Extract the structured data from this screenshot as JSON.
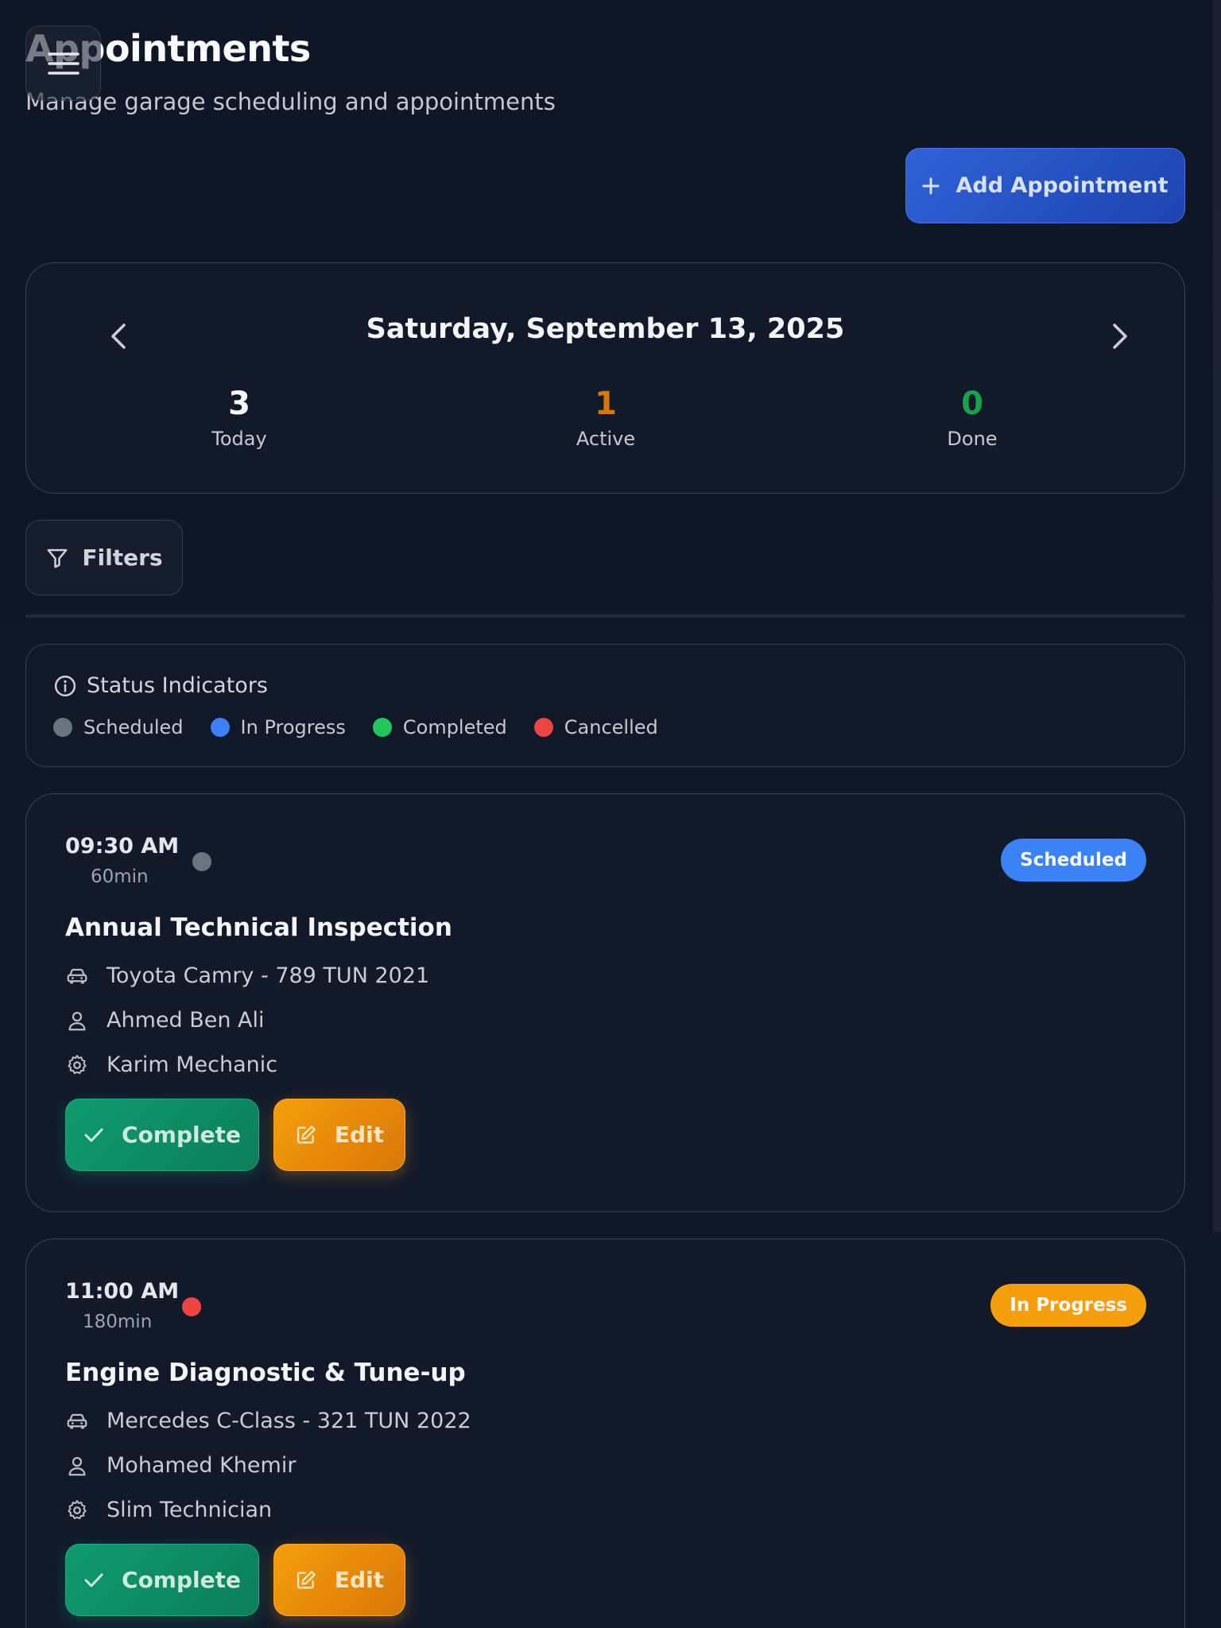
{
  "header": {
    "title": "Appointments",
    "subtitle": "Manage garage scheduling and appointments",
    "menu_icon": "hamburger-icon",
    "add_button_label": "Add Appointment"
  },
  "date_nav": {
    "date": "Saturday, September 13, 2025",
    "stats": [
      {
        "value": "3",
        "label": "Today",
        "color": "#f9fafb"
      },
      {
        "value": "1",
        "label": "Active",
        "color": "#d97706"
      },
      {
        "value": "0",
        "label": "Done",
        "color": "#16a34a"
      }
    ]
  },
  "filters": {
    "label": "Filters"
  },
  "legend": {
    "title": "Status Indicators",
    "items": [
      {
        "label": "Scheduled",
        "color": "#6b7280"
      },
      {
        "label": "In Progress",
        "color": "#3b82f6"
      },
      {
        "label": "Completed",
        "color": "#22c55e"
      },
      {
        "label": "Cancelled",
        "color": "#ef4444"
      }
    ]
  },
  "appointments": [
    {
      "time": "09:30 AM",
      "duration": "60min",
      "dot_color": "#6b7280",
      "status": "Scheduled",
      "status_color": "#3b82f6",
      "title": "Annual Technical Inspection",
      "vehicle": "Toyota Camry - 789 TUN 2021",
      "customer": "Ahmed Ben Ali",
      "mechanic": "Karim Mechanic",
      "complete_label": "Complete",
      "edit_label": "Edit"
    },
    {
      "time": "11:00 AM",
      "duration": "180min",
      "dot_color": "#ef4444",
      "status": "In Progress",
      "status_color": "#f59e0b",
      "title": "Engine Diagnostic & Tune-up",
      "vehicle": "Mercedes C-Class - 321 TUN 2022",
      "customer": "Mohamed Khemir",
      "mechanic": "Slim Technician",
      "complete_label": "Complete",
      "edit_label": "Edit"
    }
  ]
}
